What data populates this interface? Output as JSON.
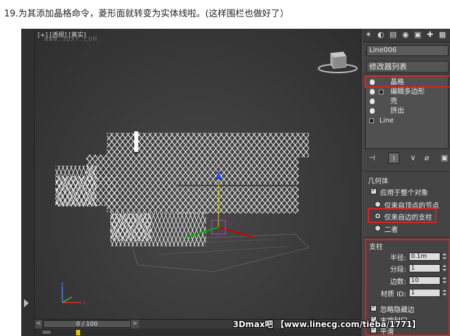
{
  "caption": "19.为其添加晶格命令，菱形面就转变为实体线啦。(这样围栏也做好了）",
  "viewport": {
    "label": "[+] [透视] [真实]",
    "watermark": "WWW.3DXY.COM"
  },
  "timeline": {
    "prev": "<",
    "frame": "0 / 100",
    "next": ">"
  },
  "panel": {
    "object_name": "Line006",
    "modifier_list": "修改器列表",
    "stack": [
      {
        "label": "晶格"
      },
      {
        "label": "编辑多边形"
      },
      {
        "label": "壳"
      },
      {
        "label": "挤出"
      },
      {
        "label": "Line"
      }
    ],
    "geometry": {
      "title": "几何体",
      "apply_all": "应用于整个对象",
      "opt_vertices": "仅来自顶点的节点",
      "opt_edges": "仅来自边的支柱",
      "opt_both": "二者"
    },
    "struts": {
      "title": "支柱",
      "radius_label": "半径:",
      "radius": "0.1m",
      "segments_label": "分段:",
      "segments": "1",
      "sides_label": "边数:",
      "sides": "10",
      "matid_label": "材质 ID:",
      "matid": "1",
      "ignore_hidden": "忽略隐藏边",
      "end_caps": "末端封口",
      "smooth": "平滑"
    }
  },
  "footer_watermark": "3Dmax吧 【www.linecg.com/tieba/1771】",
  "colors": {
    "highlight": "#e02020",
    "viewport_bg": "#3c3c3c",
    "panel_bg": "#444444"
  }
}
